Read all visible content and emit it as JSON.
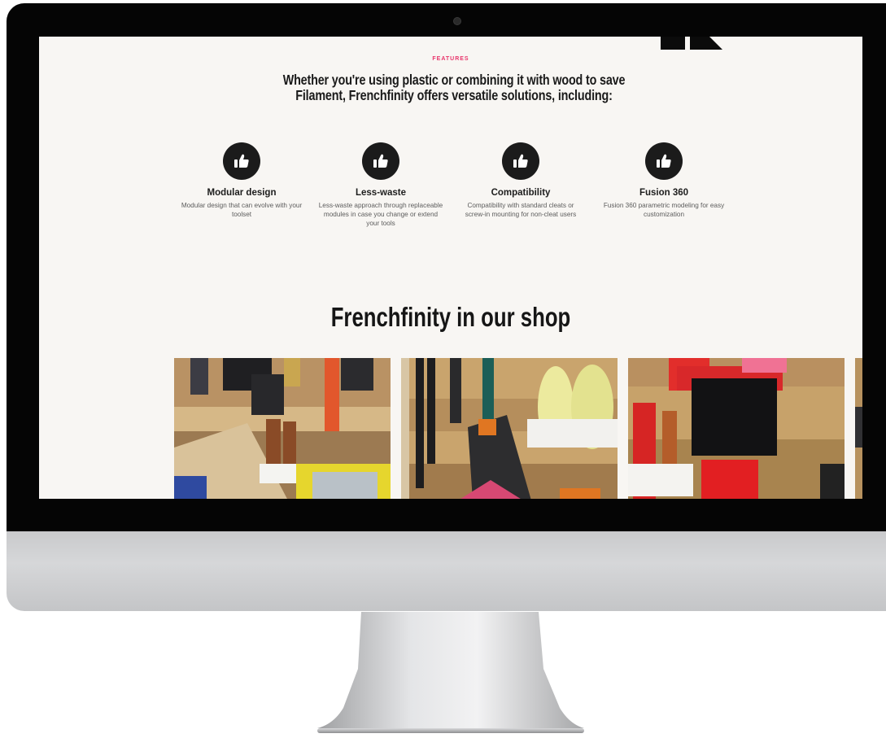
{
  "page": {
    "eyebrow": "FEATURES",
    "headline": "Whether you're using plastic or combining it with wood to save Filament, Frenchfinity offers versatile solutions, including:",
    "section_title": "Frenchfinity in our shop"
  },
  "features": [
    {
      "title": "Modular design",
      "desc": "Modular design that can evolve with your toolset",
      "icon": "thumbs-up-icon"
    },
    {
      "title": "Less-waste",
      "desc": "Less-waste approach through replaceable modules in case you change or extend your tools",
      "icon": "thumbs-up-icon"
    },
    {
      "title": "Compatibility",
      "desc": "Compatibility with standard cleats or screw-in mounting for non-cleat users",
      "icon": "thumbs-up-icon"
    },
    {
      "title": "Fusion 360",
      "desc": "Fusion 360 parametric modeling for easy customization",
      "icon": "thumbs-up-icon"
    }
  ],
  "colors": {
    "accent": "#e8356b",
    "text_dark": "#1a1a1a",
    "screen_bg": "#f8f6f3",
    "bezel": "#050505"
  }
}
